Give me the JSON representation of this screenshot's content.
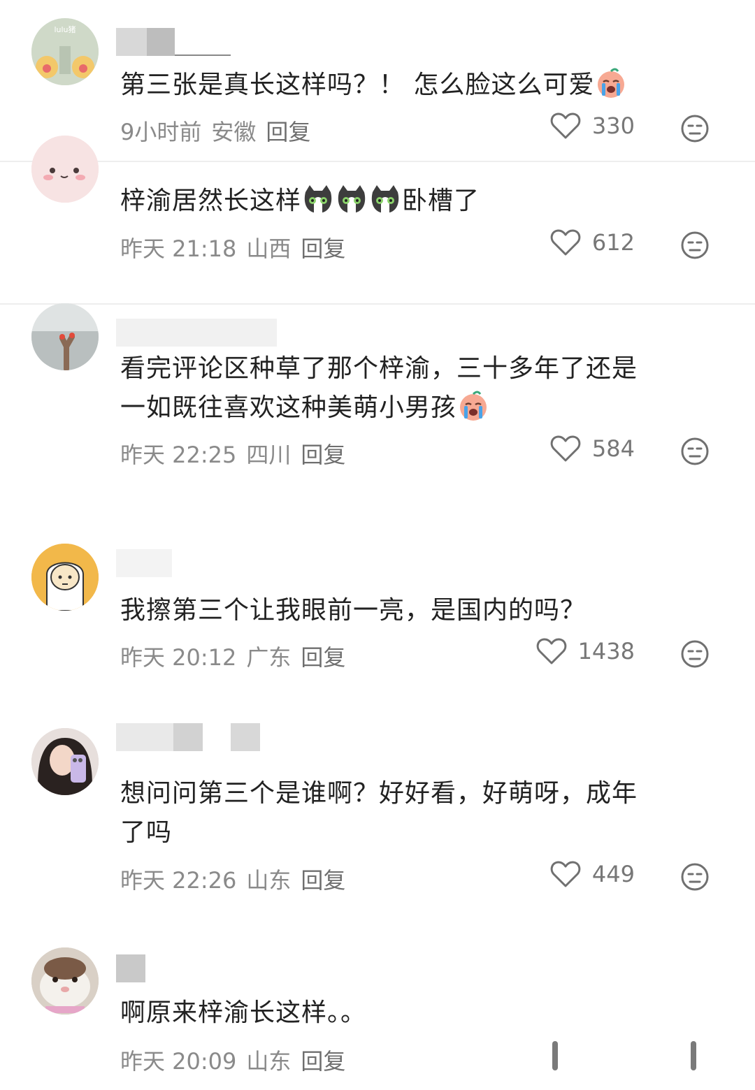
{
  "comments": [
    {
      "text": [
        "第三张是真长这样吗？！ 怎么脸这么可爱"
      ],
      "emoji": "crying-face-emoji",
      "time": "9小时前",
      "location": "安徽",
      "reply": "回复",
      "likes": "330"
    },
    {
      "text": [
        "梓渝居然长这样",
        "卧槽了"
      ],
      "emoji": "cat-face-emoji",
      "time": "昨天 21:18",
      "location": "山西",
      "reply": "回复",
      "likes": "612"
    },
    {
      "text": [
        "看完评论区种草了那个梓渝，三十多年了还是",
        "一如既往喜欢这种美萌小男孩"
      ],
      "emoji": "crying-face-emoji",
      "time": "昨天 22:25",
      "location": "四川",
      "reply": "回复",
      "likes": "584"
    },
    {
      "text": [
        "我擦第三个让我眼前一亮，是国内的吗？"
      ],
      "time": "昨天 20:12",
      "location": "广东",
      "reply": "回复",
      "likes": "1438"
    },
    {
      "text": [
        "想问问第三个是谁啊？好好看，好萌呀，成年",
        "了吗"
      ],
      "time": "昨天 22:26",
      "location": "山东",
      "reply": "回复",
      "likes": "449"
    },
    {
      "text": [
        "啊原来梓渝长这样。。"
      ],
      "time": "昨天 20:09",
      "location": "山东",
      "reply": "回复"
    }
  ],
  "avatar_labels": {
    "first": "lulu猪"
  },
  "colors": {
    "text": "#222222",
    "meta": "#8a8a8a",
    "icon": "#6f6f6f",
    "divider": "#eeeeee",
    "blur": "#d6d6d6"
  }
}
